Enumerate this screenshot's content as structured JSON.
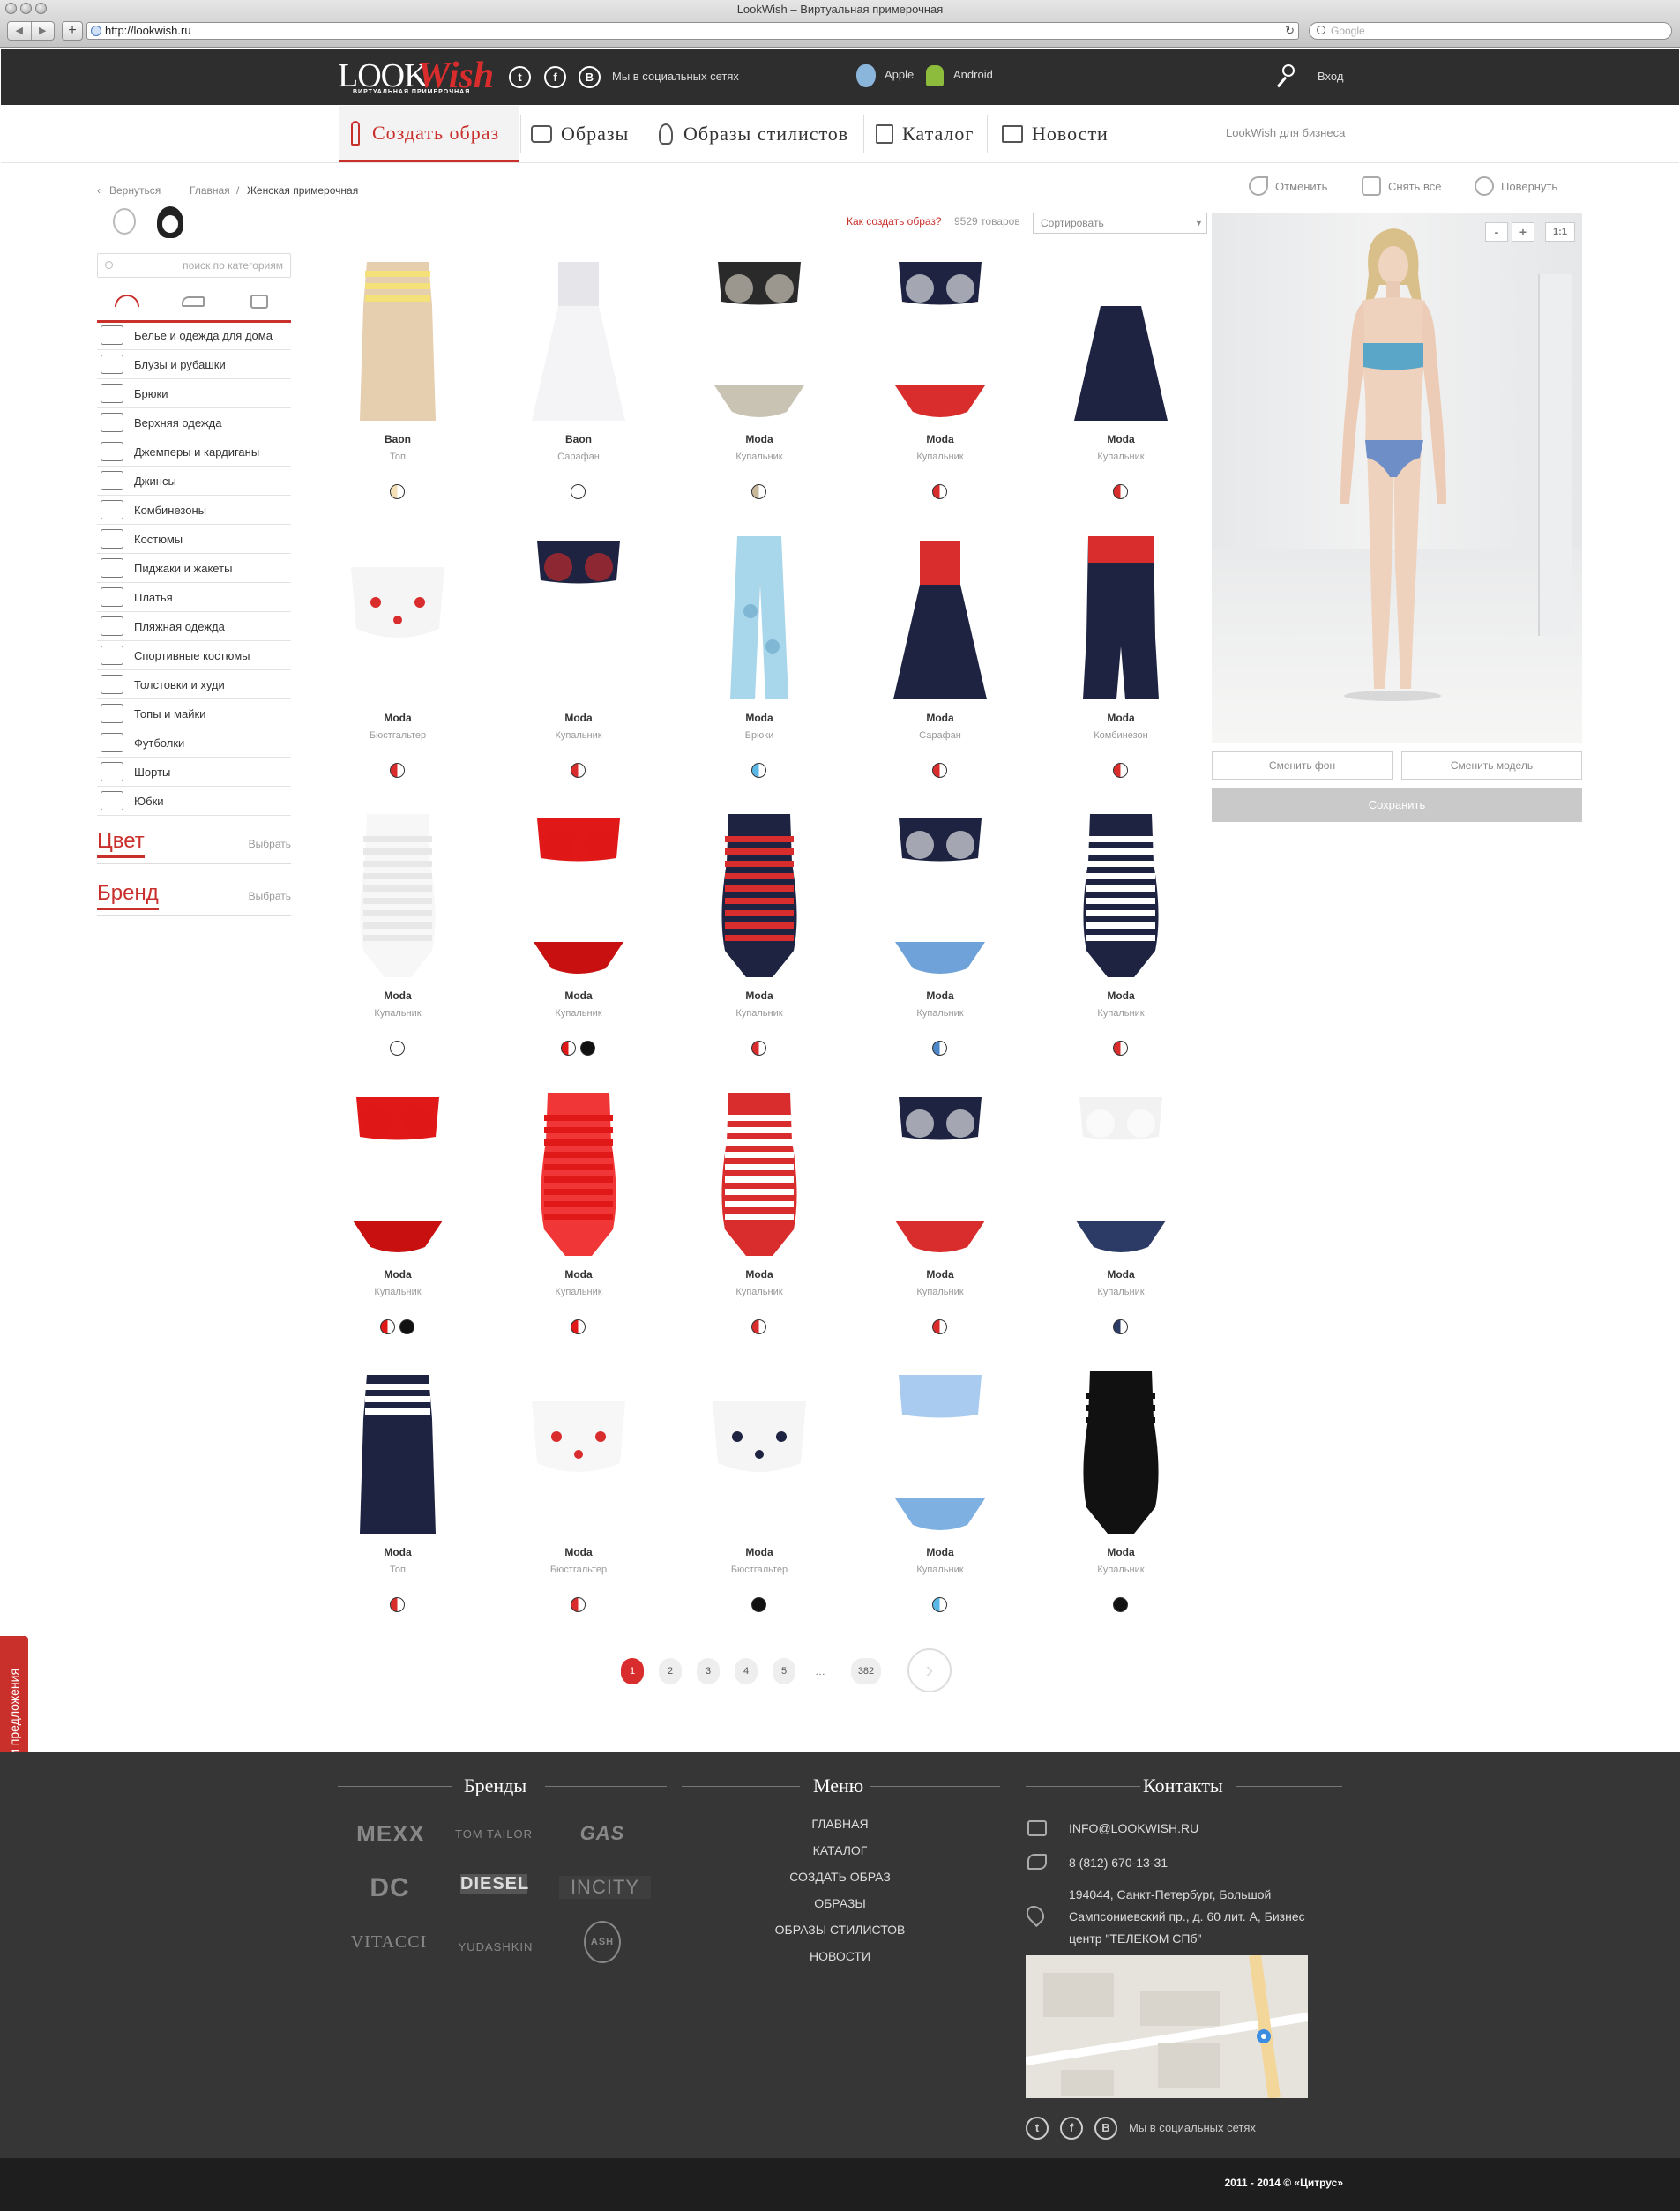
{
  "browser": {
    "title": "LookWish – Виртуальная примерочная",
    "url": "http://lookwish.ru",
    "search_placeholder": "Google"
  },
  "topbar": {
    "social_text": "Мы в социальных сетях",
    "apple": "Apple",
    "android": "Android",
    "login": "Вход",
    "logo_main": "LOOK",
    "logo_script": "Wish",
    "logo_sub": "ВИРТУАЛЬНАЯ ПРИМЕРОЧНАЯ"
  },
  "nav": {
    "items": [
      {
        "label": "Создать образ"
      },
      {
        "label": "Образы"
      },
      {
        "label": "Образы стилистов"
      },
      {
        "label": "Каталог"
      },
      {
        "label": "Новости"
      }
    ],
    "business_link": "LookWish для бизнеса"
  },
  "breadcrumb": {
    "back": "Вернуться",
    "home": "Главная",
    "current": "Женская примерочная"
  },
  "sidebar": {
    "search_placeholder": "поиск по категориям",
    "categories": [
      {
        "label": "Белье и одежда для дома"
      },
      {
        "label": "Блузы и рубашки"
      },
      {
        "label": "Брюки"
      },
      {
        "label": "Верхняя одежда"
      },
      {
        "label": "Джемперы и кардиганы"
      },
      {
        "label": "Джинсы"
      },
      {
        "label": "Комбинезоны"
      },
      {
        "label": "Костюмы"
      },
      {
        "label": "Пиджаки и жакеты"
      },
      {
        "label": "Платья"
      },
      {
        "label": "Пляжная одежда"
      },
      {
        "label": "Спортивные костюмы"
      },
      {
        "label": "Толстовки и худи"
      },
      {
        "label": "Топы и майки"
      },
      {
        "label": "Футболки"
      },
      {
        "label": "Шорты"
      },
      {
        "label": "Юбки"
      }
    ],
    "color_filter": "Цвет",
    "brand_filter": "Бренд",
    "pick": "Выбрать"
  },
  "catalog": {
    "howto": "Как создать образ?",
    "count": "9529 товаров",
    "sort": "Сортировать",
    "products": [
      {
        "brand": "Baon",
        "type": "Топ",
        "swatches": [
          "#f4dfb7"
        ]
      },
      {
        "brand": "Baon",
        "type": "Сарафан",
        "swatches": [
          "#ffffff"
        ]
      },
      {
        "brand": "Moda",
        "type": "Купальник",
        "swatches": [
          "#c8b89a"
        ]
      },
      {
        "brand": "Moda",
        "type": "Купальник",
        "swatches": [
          "#d92c2c"
        ]
      },
      {
        "brand": "Moda",
        "type": "Купальник",
        "swatches": [
          "#d92c2c"
        ]
      },
      {
        "brand": "Moda",
        "type": "Бюстгальтер",
        "swatches": [
          "#d92c2c"
        ]
      },
      {
        "brand": "Moda",
        "type": "Купальник",
        "swatches": [
          "#d92c2c"
        ]
      },
      {
        "brand": "Moda",
        "type": "Брюки",
        "swatches": [
          "#5bb8e6"
        ]
      },
      {
        "brand": "Moda",
        "type": "Сарафан",
        "swatches": [
          "#d92c2c"
        ]
      },
      {
        "brand": "Moda",
        "type": "Комбинезон",
        "swatches": [
          "#d92c2c"
        ]
      },
      {
        "brand": "Moda",
        "type": "Купальник",
        "swatches": [
          "#ffffff"
        ]
      },
      {
        "brand": "Moda",
        "type": "Купальник",
        "swatches": [
          "#e01818",
          "#111111"
        ]
      },
      {
        "brand": "Moda",
        "type": "Купальник",
        "swatches": [
          "#d92c2c"
        ]
      },
      {
        "brand": "Moda",
        "type": "Купальник",
        "swatches": [
          "#4a86c8"
        ]
      },
      {
        "brand": "Moda",
        "type": "Купальник",
        "swatches": [
          "#d92c2c"
        ]
      },
      {
        "brand": "Moda",
        "type": "Купальник",
        "swatches": [
          "#e01818",
          "#111111"
        ]
      },
      {
        "brand": "Moda",
        "type": "Купальник",
        "swatches": [
          "#e01818"
        ]
      },
      {
        "brand": "Moda",
        "type": "Купальник",
        "swatches": [
          "#d92c2c"
        ]
      },
      {
        "brand": "Moda",
        "type": "Купальник",
        "swatches": [
          "#d92c2c"
        ]
      },
      {
        "brand": "Moda",
        "type": "Купальник",
        "swatches": [
          "#2c3a66"
        ]
      },
      {
        "brand": "Moda",
        "type": "Топ",
        "swatches": [
          "#d92c2c"
        ]
      },
      {
        "brand": "Moda",
        "type": "Бюстгальтер",
        "swatches": [
          "#d92c2c"
        ]
      },
      {
        "brand": "Moda",
        "type": "Бюстгальтер",
        "swatches": [
          "#111111"
        ]
      },
      {
        "brand": "Moda",
        "type": "Купальник",
        "swatches": [
          "#5bb8e6"
        ]
      },
      {
        "brand": "Moda",
        "type": "Купальник",
        "swatches": [
          "#111111"
        ]
      }
    ],
    "pages": [
      "1",
      "2",
      "3",
      "4",
      "5",
      "…",
      "382"
    ]
  },
  "model": {
    "undo": "Отменить",
    "remove_all": "Снять все",
    "rotate": "Повернуть",
    "zoom_out": "-",
    "zoom_in": "+",
    "zoom_reset": "1:1",
    "change_bg": "Сменить фон",
    "change_model": "Сменить модель",
    "save": "Сохранить"
  },
  "feedback": "Отзывы и предложения",
  "footer": {
    "brands_title": "Бренды",
    "menu_title": "Меню",
    "contacts_title": "Контакты",
    "brands": [
      "MEXX",
      "TOM TAILOR",
      "GAS",
      "DC",
      "DIESEL",
      "INCITY",
      "VITACCI",
      "YUDASHKIN",
      "ASH"
    ],
    "menu": [
      "ГЛАВНАЯ",
      "КАТАЛОГ",
      "СОЗДАТЬ ОБРАЗ",
      "ОБРАЗЫ",
      "ОБРАЗЫ СТИЛИСТОВ",
      "НОВОСТИ"
    ],
    "email": "INFO@LOOKWISH.RU",
    "phone": "8 (812) 670-13-31",
    "address": "194044, Санкт-Петербург, Большой Сампсониевский пр., д. 60 лит. А, Бизнес центр \"ТЕЛЕКОМ СПб\"",
    "social_text": "Мы в социальных сетях",
    "copyright": "2011 - 2014 © «Цитрус»"
  },
  "colors": {
    "accent": "#c9302c",
    "dark": "#2e2e2e",
    "footer": "#363636"
  }
}
